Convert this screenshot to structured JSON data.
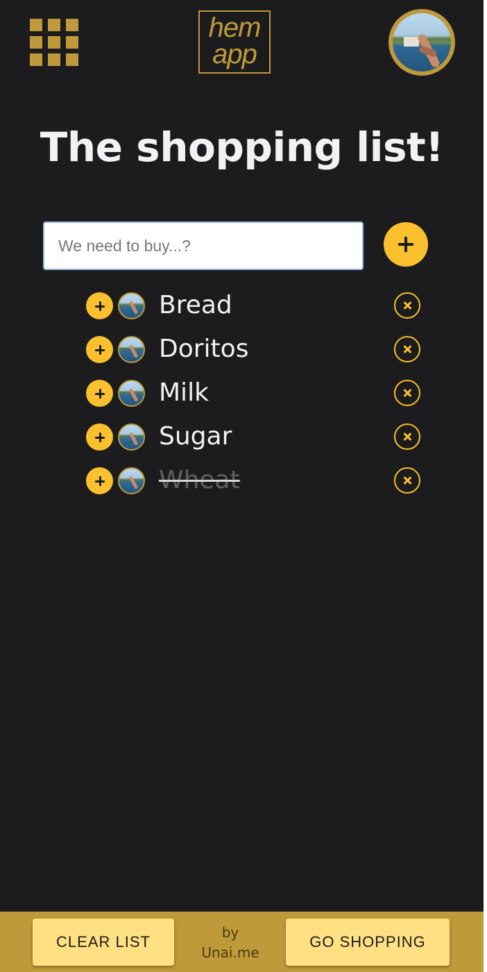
{
  "header": {
    "menu_icon": "grid-menu-icon",
    "logo_line1": "hem",
    "logo_line2": "app",
    "avatar_icon": "user-avatar"
  },
  "title": "The shopping list!",
  "add": {
    "placeholder": "We need to buy...?",
    "value": "",
    "button_icon": "plus-icon"
  },
  "items": [
    {
      "label": "Bread",
      "done": false
    },
    {
      "label": "Doritos",
      "done": false
    },
    {
      "label": "Milk",
      "done": false
    },
    {
      "label": "Sugar",
      "done": false
    },
    {
      "label": "Wheat",
      "done": true
    }
  ],
  "footer": {
    "clear_label": "CLEAR LIST",
    "credit_line1": "by",
    "credit_line2": "Unai.me",
    "shop_label": "GO SHOPPING"
  },
  "colors": {
    "background": "#1c1c1e",
    "accent": "#fbc02d",
    "gold": "#bf9a3a",
    "button_light": "#ffe082"
  }
}
